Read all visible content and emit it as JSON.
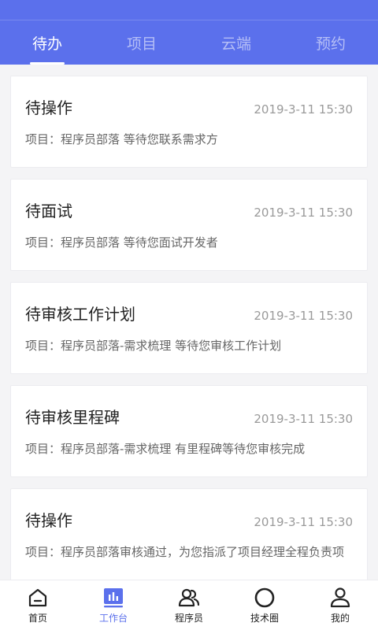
{
  "tabs": [
    {
      "label": "待办",
      "active": true
    },
    {
      "label": "项目",
      "active": false
    },
    {
      "label": "云端",
      "active": false
    },
    {
      "label": "预约",
      "active": false
    }
  ],
  "tasks": [
    {
      "title": "待操作",
      "time": "2019-3-11 15:30",
      "desc": "项目：程序员部落  等待您联系需求方"
    },
    {
      "title": "待面试",
      "time": "2019-3-11 15:30",
      "desc": "项目：程序员部落  等待您面试开发者"
    },
    {
      "title": "待审核工作计划",
      "time": "2019-3-11 15:30",
      "desc": "项目：程序员部落-需求梳理  等待您审核工作计划"
    },
    {
      "title": "待审核里程碑",
      "time": "2019-3-11 15:30",
      "desc": "项目：程序员部落-需求梳理  有里程碑等待您审核完成"
    },
    {
      "title": "待操作",
      "time": "2019-3-11 15:30",
      "desc": "项目：程序员部落审核通过，为您指派了项目经理全程负责项"
    }
  ],
  "nav": [
    {
      "label": "首页",
      "icon": "home-icon"
    },
    {
      "label": "工作台",
      "icon": "workbench-icon",
      "active": true
    },
    {
      "label": "程序员",
      "icon": "programmers-icon"
    },
    {
      "label": "技术圈",
      "icon": "circle-icon"
    },
    {
      "label": "我的",
      "icon": "profile-icon"
    }
  ],
  "colors": {
    "primary": "#5b70ec",
    "text": "#222222",
    "muted": "#9a9a9a"
  }
}
